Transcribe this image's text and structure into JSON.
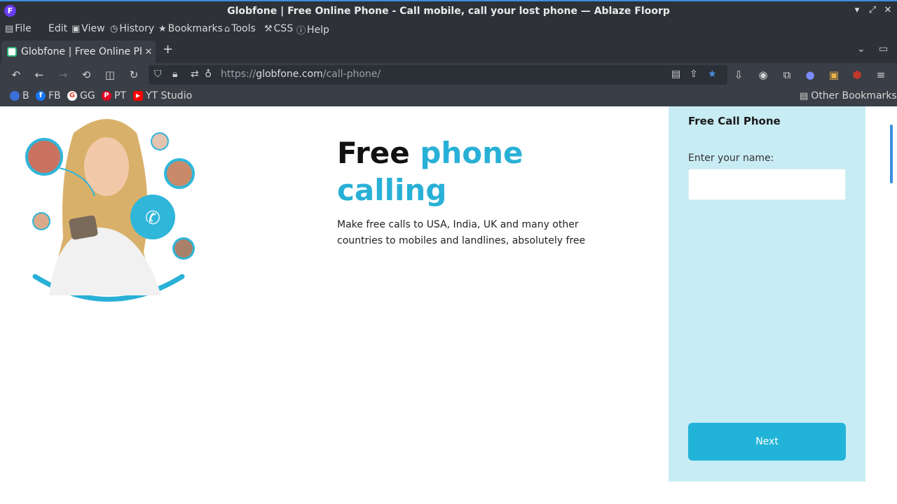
{
  "window": {
    "title": "Globfone | Free Online Phone - Call mobile, call your lost phone — Ablaze Floorp",
    "app_logo_letter": "F"
  },
  "menu": {
    "items": [
      {
        "label": "File",
        "icon": "file-icon"
      },
      {
        "label": "Edit",
        "icon": ""
      },
      {
        "label": "View",
        "icon": "view-icon"
      },
      {
        "label": "History",
        "icon": "clock-icon"
      },
      {
        "label": "Bookmarks",
        "icon": "star-icon"
      },
      {
        "label": "Tools",
        "icon": "toolbox-icon"
      },
      {
        "label": "CSS",
        "icon": "wrench-icon"
      },
      {
        "label": "Help",
        "icon": "help-icon"
      }
    ]
  },
  "tabs": [
    {
      "label": "Globfone | Free Online Phone",
      "active": true
    }
  ],
  "urlbar": {
    "url_prefix": "https://",
    "url_host": "globfone.com",
    "url_path": "/call-phone/"
  },
  "bookmarks": {
    "items": [
      {
        "label": "B",
        "color": "#3b6fd8"
      },
      {
        "label": "FB",
        "color": "#1877f2"
      },
      {
        "label": "GG",
        "color": "#ea4335"
      },
      {
        "label": "PT",
        "color": "#e60023"
      },
      {
        "label": "YT Studio",
        "color": "#ff0000"
      }
    ],
    "other": "Other Bookmarks"
  },
  "page": {
    "headline_word1": "Free",
    "headline_word2": "phone",
    "headline_word3": "calling",
    "subtext": "Make free calls to USA, India, UK and many other countries to mobiles and landlines, absolutely free",
    "panel": {
      "title": "Free Call Phone",
      "name_label": "Enter your name:",
      "name_value": "",
      "next_button": "Next"
    }
  },
  "colors": {
    "accent": "#29b0d6",
    "panel_bg": "#c8ecf4",
    "button": "#22b3d8"
  }
}
